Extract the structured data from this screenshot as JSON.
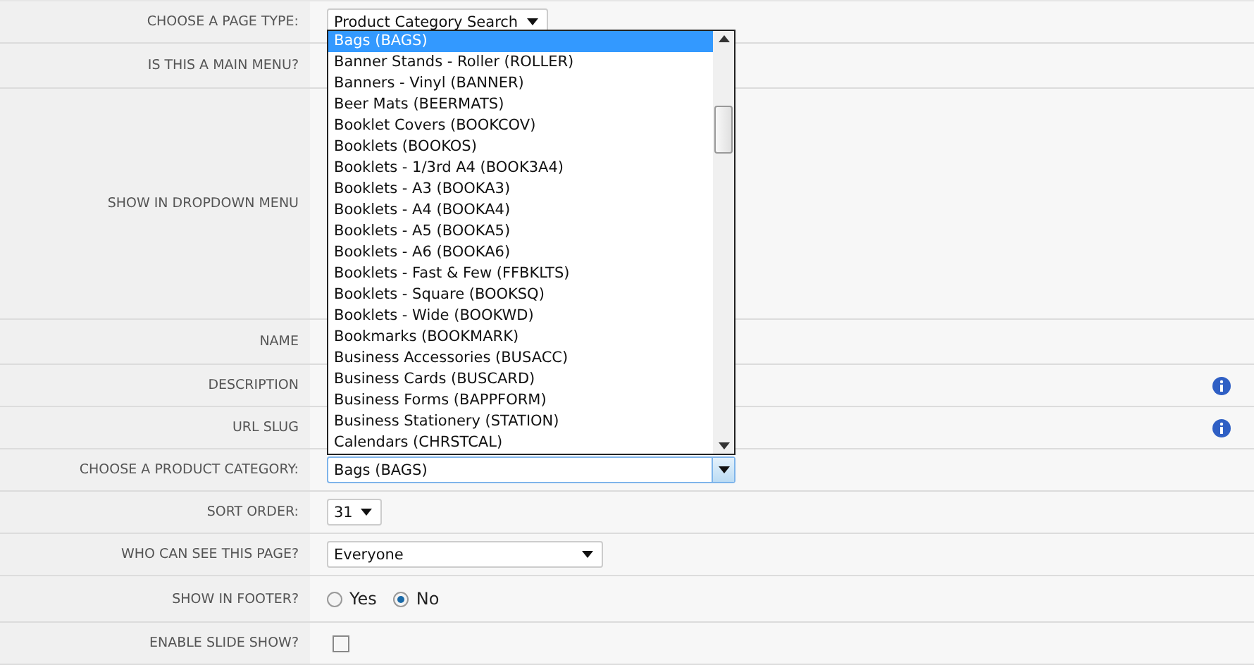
{
  "rows": [
    {
      "label": "CHOOSE A PAGE TYPE:",
      "kind": "select",
      "value": "Product Category Search"
    },
    {
      "label": "IS THIS A MAIN MENU?",
      "kind": "blank"
    },
    {
      "label": "SHOW IN DROPDOWN MENU",
      "kind": "spacer"
    },
    {
      "label": "NAME",
      "kind": "blank"
    },
    {
      "label": "DESCRIPTION",
      "kind": "info"
    },
    {
      "label": "URL SLUG",
      "kind": "info"
    },
    {
      "label": "CHOOSE A PRODUCT CATEGORY:",
      "kind": "combo",
      "focused": true,
      "value": "Bags (BAGS)"
    },
    {
      "label": "SORT ORDER:",
      "kind": "select",
      "value": "31"
    },
    {
      "label": "WHO CAN SEE THIS PAGE?",
      "kind": "picker",
      "value": "Everyone"
    },
    {
      "label": "SHOW IN FOOTER?",
      "kind": "radio",
      "options": [
        {
          "label": "Yes",
          "selected": false
        },
        {
          "label": "No",
          "selected": true
        }
      ]
    },
    {
      "label": "ENABLE SLIDE SHOW?",
      "kind": "checkbox",
      "checked": false
    }
  ],
  "dropdown": {
    "options": [
      {
        "label": "Bags (BAGS)",
        "selected": true
      },
      {
        "label": "Banner Stands - Roller (ROLLER)",
        "selected": false
      },
      {
        "label": "Banners - Vinyl (BANNER)",
        "selected": false
      },
      {
        "label": "Beer Mats (BEERMATS)",
        "selected": false
      },
      {
        "label": "Booklet Covers (BOOKCOV)",
        "selected": false
      },
      {
        "label": "Booklets (BOOKOS)",
        "selected": false
      },
      {
        "label": "Booklets - 1/3rd A4 (BOOK3A4)",
        "selected": false
      },
      {
        "label": "Booklets - A3 (BOOKA3)",
        "selected": false
      },
      {
        "label": "Booklets - A4 (BOOKA4)",
        "selected": false
      },
      {
        "label": "Booklets - A5 (BOOKA5)",
        "selected": false
      },
      {
        "label": "Booklets - A6 (BOOKA6)",
        "selected": false
      },
      {
        "label": "Booklets - Fast & Few (FFBKLTS)",
        "selected": false
      },
      {
        "label": "Booklets - Square (BOOKSQ)",
        "selected": false
      },
      {
        "label": "Booklets - Wide (BOOKWD)",
        "selected": false
      },
      {
        "label": "Bookmarks (BOOKMARK)",
        "selected": false
      },
      {
        "label": "Business Accessories (BUSACC)",
        "selected": false
      },
      {
        "label": "Business Cards (BUSCARD)",
        "selected": false
      },
      {
        "label": "Business Forms (BAPPFORM)",
        "selected": false
      },
      {
        "label": "Business Stationery (STATION)",
        "selected": false
      },
      {
        "label": "Calendars (CHRSTCAL)",
        "selected": false
      }
    ]
  }
}
